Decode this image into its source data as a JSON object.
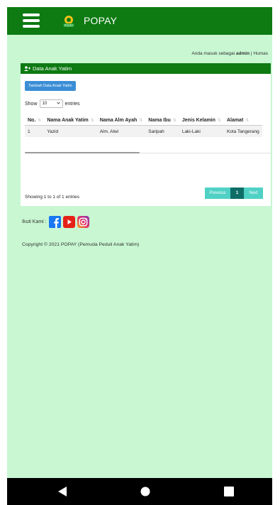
{
  "app": {
    "title": "POPAY"
  },
  "login": {
    "prefix": "Anda masuk sebagai",
    "user": "admin",
    "separator": "|",
    "role": "Humas"
  },
  "card": {
    "title": "Data Anak Yatim",
    "add_button": "Tambah Data Anak Yatim",
    "show_label": "Show",
    "entries_value": "10",
    "entries_label": "entries",
    "columns": [
      "No.",
      "Nama Anak Yatim",
      "Nama Alm Ayah",
      "Nama Ibu",
      "Jenis Kelamin",
      "Alamat"
    ],
    "rows": [
      [
        "1",
        "Yazid",
        "Alm. Alwi",
        "Saripah",
        "Laki-Laki",
        "Kota Tangerang"
      ]
    ],
    "showing_text": "Showing 1 to 1 of 1 entries",
    "pagination": {
      "previous": "Previous",
      "current": "1",
      "next": "Next"
    }
  },
  "footer": {
    "follow_label": "Ikuti Kami :",
    "copyright": "Copyright © 2021 POPAY (Pemuda Peduli Anak Yatim)"
  },
  "colors": {
    "header_green": "#0d7a12",
    "background": "#c8f7d2",
    "button_blue": "#3b8ed6",
    "pager_teal": "#4fd1c5"
  },
  "icons": {
    "menu": "hamburger-icon",
    "logo": "popay-logo",
    "user": "user-plus-icon",
    "facebook": "facebook-icon",
    "youtube": "youtube-icon",
    "instagram": "instagram-icon"
  }
}
